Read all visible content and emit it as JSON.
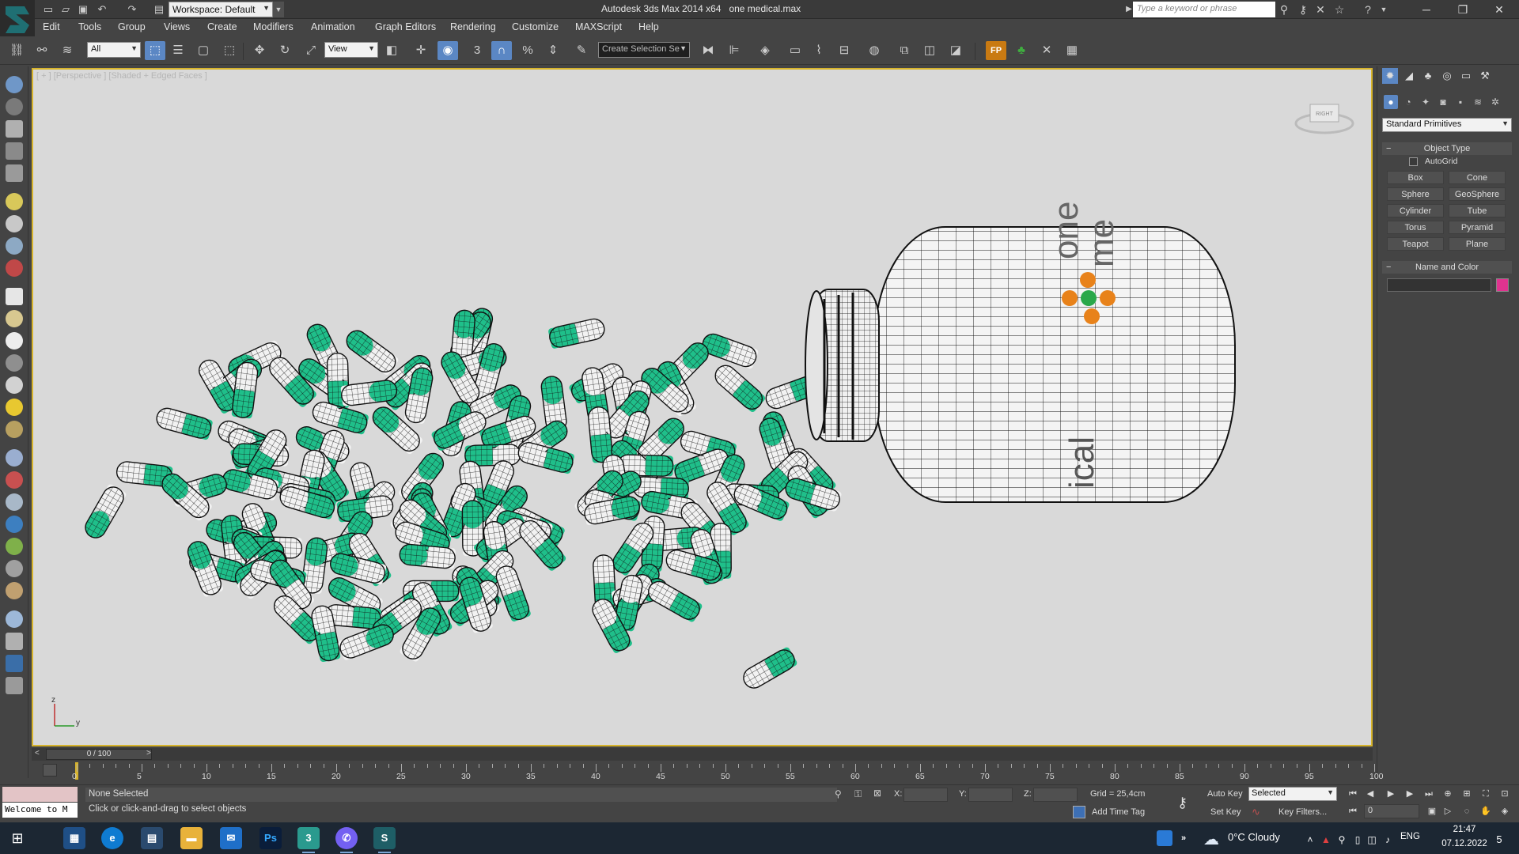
{
  "titlebar": {
    "workspace_label": "Workspace: Default",
    "app_title": "Autodesk 3ds Max  2014 x64",
    "file_name": "one medical.max",
    "search_placeholder": "Type a keyword or phrase"
  },
  "menu": [
    "Edit",
    "Tools",
    "Group",
    "Views",
    "Create",
    "Modifiers",
    "Animation",
    "Graph Editors",
    "Rendering",
    "Customize",
    "MAXScript",
    "Help"
  ],
  "toolbar": {
    "selection_filter": "All",
    "reference_coord": "View",
    "named_selection": "Create Selection Se",
    "snap_label": "3",
    "fp_label": "FP"
  },
  "viewport": {
    "label": "[ + ] [Perspective ] [Shaded + Edged Faces ]",
    "viewcube_face": "RIGHT",
    "axis_z": "z",
    "axis_y": "y",
    "bottle_text_top": "one",
    "bottle_text_mid": "me",
    "bottle_text_bottom": "ical",
    "capsule_color": "#1fbf8a",
    "bottle_dot_colors": [
      "#e8821a",
      "#2aa84a"
    ]
  },
  "command_panel": {
    "category": "Standard Primitives",
    "object_type_title": "Object Type",
    "autogrid_label": "AutoGrid",
    "primitives": [
      "Box",
      "Cone",
      "Sphere",
      "GeoSphere",
      "Cylinder",
      "Tube",
      "Torus",
      "Pyramid",
      "Teapot",
      "Plane"
    ],
    "name_color_title": "Name and Color",
    "object_color": "#e0338f"
  },
  "timeline": {
    "slider_label": "0 / 100",
    "ticks": [
      "0",
      "5",
      "10",
      "15",
      "20",
      "25",
      "30",
      "35",
      "40",
      "45",
      "50",
      "55",
      "60",
      "65",
      "70",
      "75",
      "80",
      "85",
      "90",
      "95",
      "100"
    ]
  },
  "status": {
    "maxscript_text": "Welcome to M",
    "selection_status": "None Selected",
    "prompt": "Click or click-and-drag to select objects",
    "x_label": "X:",
    "y_label": "Y:",
    "z_label": "Z:",
    "grid": "Grid = 25,4cm",
    "add_time_tag": "Add Time Tag",
    "auto_key": "Auto Key",
    "set_key": "Set Key",
    "key_mode": "Selected",
    "key_filters": "Key Filters...",
    "current_frame": "0"
  },
  "taskbar": {
    "weather": "0°C  Cloudy",
    "language": "ENG",
    "time": "21:47",
    "date": "07.12.2022",
    "notification_count": "5"
  }
}
